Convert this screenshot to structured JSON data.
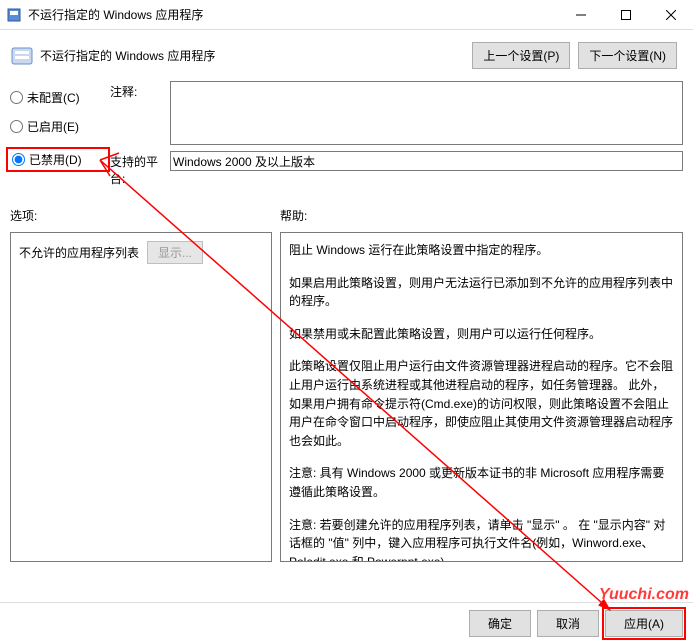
{
  "titlebar": {
    "title": "不运行指定的 Windows 应用程序"
  },
  "header": {
    "title": "不运行指定的 Windows 应用程序",
    "prev_btn": "上一个设置(P)",
    "next_btn": "下一个设置(N)"
  },
  "radios": {
    "unconfigured": "未配置(C)",
    "enabled": "已启用(E)",
    "disabled": "已禁用(D)",
    "selected": "disabled"
  },
  "fields": {
    "comment_label": "注释:",
    "comment_value": "",
    "platform_label": "支持的平台:",
    "platform_value": "Windows 2000 及以上版本"
  },
  "mid": {
    "options_label": "选项:",
    "help_label": "帮助:"
  },
  "options": {
    "list_label": "不允许的应用程序列表",
    "display_btn": "显示..."
  },
  "help": {
    "p1": "阻止 Windows 运行在此策略设置中指定的程序。",
    "p2": "如果启用此策略设置，则用户无法运行已添加到不允许的应用程序列表中的程序。",
    "p3": "如果禁用或未配置此策略设置，则用户可以运行任何程序。",
    "p4": "此策略设置仅阻止用户运行由文件资源管理器进程启动的程序。它不会阻止用户运行由系统进程或其他进程启动的程序，如任务管理器。 此外，如果用户拥有命令提示符(Cmd.exe)的访问权限，则此策略设置不会阻止用户在命令窗口中启动程序，即使应阻止其使用文件资源管理器启动程序也会如此。",
    "p5": "注意: 具有 Windows 2000 或更新版本证书的非 Microsoft 应用程序需要遵循此策略设置。",
    "p6": "注意: 若要创建允许的应用程序列表，请单击 \"显示\" 。 在 \"显示内容\" 对话框的 \"值\" 列中，键入应用程序可执行文件名(例如，Winword.exe、Poledit.exe 和 Powerpnt.exe)。"
  },
  "footer": {
    "ok": "确定",
    "cancel": "取消",
    "apply": "应用(A)"
  },
  "watermark": "Yuuchi.com"
}
